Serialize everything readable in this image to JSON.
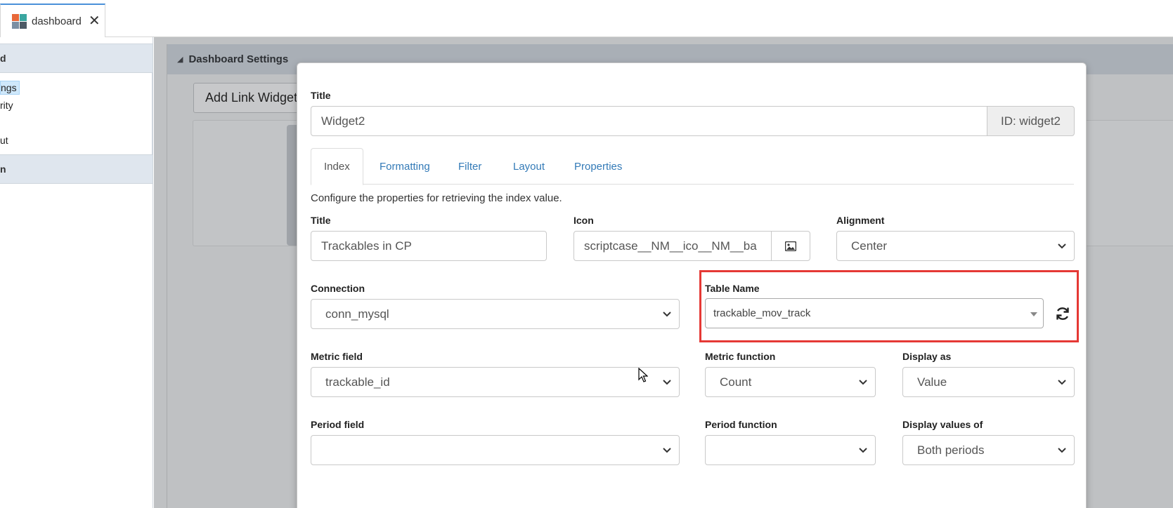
{
  "tab": {
    "label": "dashboard",
    "close": "✕"
  },
  "sidebar": {
    "header1": "d",
    "items": [
      "ngs",
      "rity",
      "",
      "ut"
    ],
    "header2": "n"
  },
  "workspace": {
    "panel_title": "Dashboard Settings",
    "add_button": "Add Link Widget"
  },
  "modal": {
    "title_label": "Title",
    "title_value": "Widget2",
    "id_addon": "ID: widget2",
    "tabs": [
      "Index",
      "Formatting",
      "Filter",
      "Layout",
      "Properties"
    ],
    "description": "Configure the properties for retrieving the index value.",
    "index_title_label": "Title",
    "index_title_value": "Trackables in CP",
    "icon_label": "Icon",
    "icon_value": "scriptcase__NM__ico__NM__ba",
    "alignment_label": "Alignment",
    "alignment_value": "Center",
    "connection_label": "Connection",
    "connection_value": "conn_mysql",
    "table_name_label": "Table Name",
    "table_name_value": "trackable_mov_track",
    "metric_field_label": "Metric field",
    "metric_field_value": "trackable_id",
    "metric_function_label": "Metric function",
    "metric_function_value": "Count",
    "display_as_label": "Display as",
    "display_as_value": "Value",
    "period_field_label": "Period field",
    "period_field_value": "",
    "period_function_label": "Period function",
    "period_function_value": "",
    "display_values_label": "Display values of",
    "display_values_value": "Both periods"
  },
  "colors": {
    "highlight": "#e53935",
    "link": "#337ab7",
    "tab_accent": "#4a90d9"
  }
}
